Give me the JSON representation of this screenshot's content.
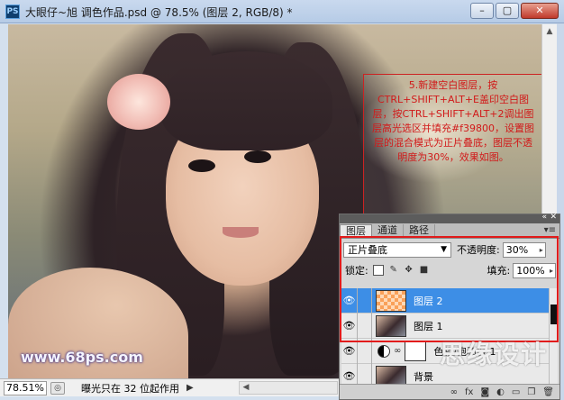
{
  "window": {
    "app_icon": "PS",
    "title": "大眼仔~旭 调色作品.psd @ 78.5% (图层 2, RGB/8) *",
    "buttons": [
      "minimize",
      "maximize",
      "close"
    ]
  },
  "canvas": {
    "annotation": "5.新建空白图层，按CTRL+SHIFT+ALT+E盖印空白图层，按CTRL+SHIFT+ALT+2调出图层高光选区并填充#f39800，设置图层的混合模式为正片叠底，图层不透明度为30%，效果如图。",
    "watermark": "www.68ps.com"
  },
  "status_bar": {
    "zoom": "78.51%",
    "info": "曝光只在 32 位起作用"
  },
  "layers_panel": {
    "tabs": [
      {
        "label": "图层",
        "active": true
      },
      {
        "label": "通道",
        "active": false
      },
      {
        "label": "路径",
        "active": false
      }
    ],
    "blend_mode": "正片叠底",
    "opacity_label": "不透明度:",
    "opacity_value": "30%",
    "lock_label": "锁定:",
    "fill_label": "填充:",
    "fill_value": "100%",
    "layers": [
      {
        "name": "图层 2",
        "selected": true,
        "thumb": "orange"
      },
      {
        "name": "图层 1",
        "selected": false,
        "thumb": "photo"
      },
      {
        "name": "色相/饱和度 1",
        "selected": false,
        "thumb": "adjustment"
      },
      {
        "name": "背景",
        "selected": false,
        "thumb": "photo"
      }
    ]
  },
  "colors": {
    "annotation_red": "#d11a1a",
    "selected_layer": "#3d8ee6",
    "fill_swatch": "#f39800"
  },
  "logo_watermark": "思缘设计"
}
